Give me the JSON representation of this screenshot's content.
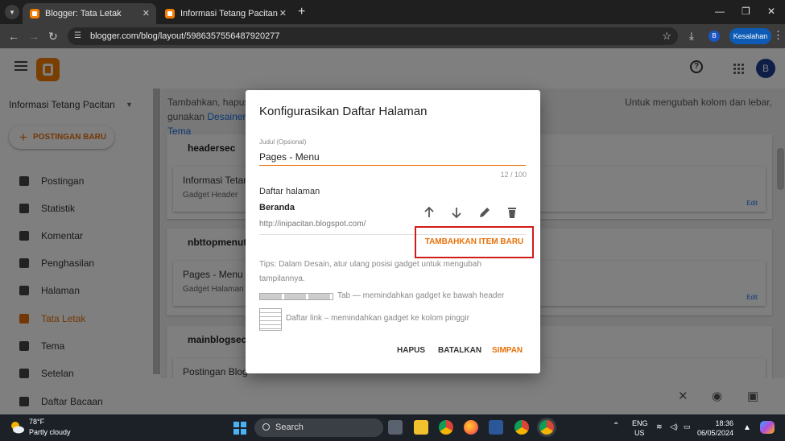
{
  "browser": {
    "tabs": [
      {
        "title": "Blogger: Tata Letak",
        "active": true
      },
      {
        "title": "Informasi Tetang Pacitan",
        "active": false
      }
    ],
    "url": "blogger.com/blog/layout/5986357556487920277",
    "profile_initial": "B",
    "error_label": "Kesalahan"
  },
  "app": {
    "blog_name": "Informasi Tetang Pacitan",
    "new_post_label": "POSTINGAN BARU",
    "nav": [
      {
        "label": "Postingan"
      },
      {
        "label": "Statistik"
      },
      {
        "label": "Komentar"
      },
      {
        "label": "Penghasilan"
      },
      {
        "label": "Halaman"
      },
      {
        "label": "Tata Letak",
        "active": true
      },
      {
        "label": "Tema"
      },
      {
        "label": "Setelan"
      },
      {
        "label": "Daftar Bacaan"
      }
    ],
    "avatar_initial": "B",
    "info_prefix": "Tambahkan, hapus",
    "info_suffix": "Untuk mengubah kolom dan lebar, gunakan",
    "info_link": "Desainer",
    "info_link2": "Tema",
    "sections": [
      {
        "title": "headersec",
        "gadget_name": "Informasi Tetang Pacitan",
        "gadget_sub": "Gadget Header",
        "edit": "Edit"
      },
      {
        "title": "nbttopmenuto",
        "gadget_name": "Pages - Menu",
        "gadget_sub": "Gadget Halaman",
        "edit": "Edit"
      },
      {
        "title": "mainblogsec",
        "gadget_name": "Postingan Blog"
      }
    ]
  },
  "dialog": {
    "title": "Konfigurasikan Daftar Halaman",
    "title_field_label": "Judul (Opsional)",
    "title_value": "Pages - Menu",
    "counter": "12 / 100",
    "pages_label": "Daftar halaman",
    "page": {
      "name": "Beranda",
      "url": "http://inipacitan.blogspot.com/"
    },
    "add_item_label": "TAMBAHKAN ITEM BARU",
    "tips": "Tips: Dalam Desain, atur ulang posisi gadget untuk mengubah tampilannya.",
    "tab_tip": "Tab — memindahkan gadget ke bawah header",
    "list_tip": "Daftar link – memindahkan gadget ke kolom pinggir",
    "buttons": {
      "delete": "HAPUS",
      "cancel": "BATALKAN",
      "save": "SIMPAN"
    },
    "colors": {
      "accent": "#e8710a",
      "highlight_box": "#d01c1c"
    }
  },
  "taskbar": {
    "temperature": "78°F",
    "weather": "Partly cloudy",
    "search_label": "Search",
    "lang_line1": "ENG",
    "lang_line2": "US",
    "time": "18:36",
    "date": "06/05/2024"
  }
}
